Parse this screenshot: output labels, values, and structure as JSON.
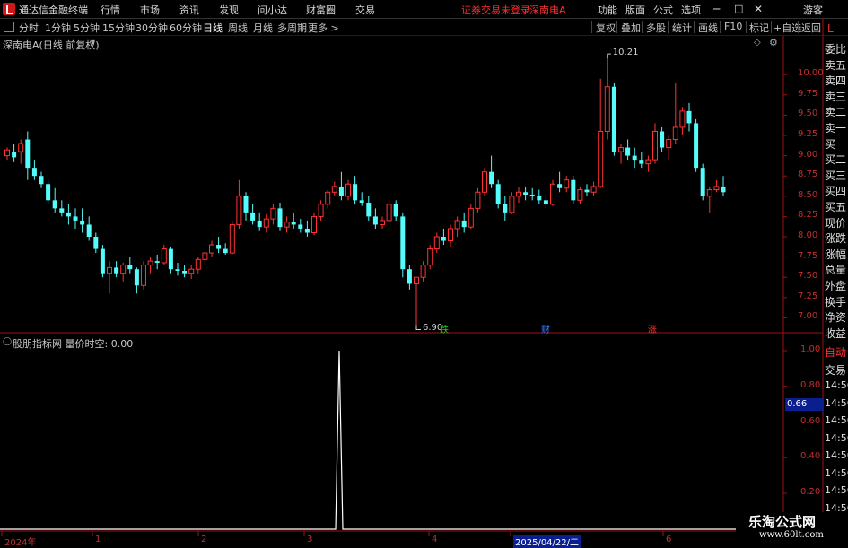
{
  "menubar": {
    "app_title": "通达信金融终端",
    "menus": [
      "行情",
      "市场",
      "资讯",
      "发现",
      "问小达",
      "财富圈",
      "交易"
    ],
    "status_text": "证券交易未登录",
    "stock_name": "深南电A",
    "right_menus": [
      "功能",
      "版面",
      "公式",
      "选项"
    ],
    "guest_label": "游客"
  },
  "periodbar": {
    "periods": [
      "分时",
      "1分钟",
      "5分钟",
      "15分钟",
      "30分钟",
      "60分钟",
      "日线",
      "周线",
      "月线",
      "多周期",
      "更多 >"
    ],
    "active_period": "日线",
    "tools": [
      "复权",
      "叠加",
      "多股",
      "统计",
      "画线",
      "F10",
      "标记",
      "+自选",
      "返回"
    ]
  },
  "main_chart": {
    "title": "深南电A(日线 前复权)",
    "high_label": "10.21",
    "low_label": "6.90",
    "y_ticks": [
      "10.00",
      "9.75",
      "9.50",
      "9.25",
      "9.00",
      "8.75",
      "8.50",
      "8.25",
      "8.00",
      "7.75",
      "7.50",
      "7.25",
      "7.00"
    ],
    "markers": [
      {
        "text": "跌",
        "color": "#22cc22"
      },
      {
        "text": "财",
        "color": "#3a78ff"
      },
      {
        "text": "涨",
        "color": "#ff3030"
      }
    ],
    "colors": {
      "up": "#ff3333",
      "down": "#54fcfc",
      "axis": "#a01010"
    }
  },
  "indicator": {
    "title": "股朋指标网  量价时空: 0.00",
    "y_ticks": [
      "1.00",
      "0.80",
      "0.60",
      "0.40",
      "0.20"
    ],
    "current_value": "0.66",
    "line_color": "#ffffff"
  },
  "right_panel": {
    "header": "L",
    "items": [
      "委比",
      "卖五",
      "卖四",
      "卖三",
      "卖二",
      "卖一",
      "买一",
      "买二",
      "买三",
      "买四",
      "买五",
      "现价",
      "涨跌",
      "涨幅",
      "总量",
      "外盘",
      "换手",
      "净资",
      "收益"
    ],
    "lower_items": [
      "自动",
      "交易",
      "14:56",
      "14:56",
      "14:56",
      "14:56",
      "14:56",
      "14:56",
      "14:56",
      "14:56",
      "14:56"
    ]
  },
  "date_axis": {
    "labels": [
      "2024年",
      "1",
      "2",
      "3",
      "4",
      "2025/04/22/二",
      "6"
    ]
  },
  "watermark": {
    "title": "乐淘公式网",
    "url": "www.60lt.com"
  },
  "chart_data": {
    "type": "candlestick",
    "title": "深南电A(日线 前复权)",
    "ylim": [
      6.85,
      10.4
    ],
    "candles": [
      [
        9.0,
        9.1,
        8.95,
        9.07
      ],
      [
        9.05,
        9.15,
        8.92,
        8.98
      ],
      [
        9.05,
        9.2,
        8.9,
        9.15
      ],
      [
        9.2,
        9.3,
        8.7,
        8.85
      ],
      [
        8.85,
        8.95,
        8.7,
        8.75
      ],
      [
        8.75,
        8.8,
        8.6,
        8.65
      ],
      [
        8.65,
        8.7,
        8.4,
        8.45
      ],
      [
        8.45,
        8.6,
        8.3,
        8.35
      ],
      [
        8.35,
        8.45,
        8.25,
        8.3
      ],
      [
        8.3,
        8.4,
        8.15,
        8.25
      ],
      [
        8.25,
        8.35,
        8.1,
        8.2
      ],
      [
        8.2,
        8.35,
        8.05,
        8.15
      ],
      [
        8.15,
        8.25,
        7.95,
        8.0
      ],
      [
        8.0,
        8.05,
        7.8,
        7.85
      ],
      [
        7.85,
        7.9,
        7.5,
        7.55
      ],
      [
        7.55,
        7.7,
        7.3,
        7.62
      ],
      [
        7.62,
        7.7,
        7.5,
        7.55
      ],
      [
        7.55,
        7.68,
        7.45,
        7.65
      ],
      [
        7.65,
        7.75,
        7.55,
        7.6
      ],
      [
        7.6,
        7.62,
        7.3,
        7.4
      ],
      [
        7.4,
        7.7,
        7.35,
        7.65
      ],
      [
        7.65,
        7.75,
        7.55,
        7.7
      ],
      [
        7.7,
        7.78,
        7.6,
        7.68
      ],
      [
        7.68,
        7.9,
        7.65,
        7.85
      ],
      [
        7.85,
        7.88,
        7.55,
        7.6
      ],
      [
        7.6,
        7.68,
        7.52,
        7.58
      ],
      [
        7.58,
        7.65,
        7.5,
        7.55
      ],
      [
        7.55,
        7.65,
        7.48,
        7.6
      ],
      [
        7.6,
        7.75,
        7.55,
        7.72
      ],
      [
        7.72,
        7.82,
        7.65,
        7.8
      ],
      [
        7.8,
        7.95,
        7.75,
        7.9
      ],
      [
        7.9,
        8.0,
        7.8,
        7.85
      ],
      [
        7.85,
        7.92,
        7.78,
        7.8
      ],
      [
        7.8,
        8.2,
        7.78,
        8.15
      ],
      [
        8.15,
        8.7,
        8.1,
        8.5
      ],
      [
        8.5,
        8.55,
        8.2,
        8.3
      ],
      [
        8.3,
        8.4,
        8.15,
        8.2
      ],
      [
        8.2,
        8.3,
        8.08,
        8.12
      ],
      [
        8.12,
        8.28,
        8.05,
        8.22
      ],
      [
        8.22,
        8.4,
        8.15,
        8.35
      ],
      [
        8.35,
        8.42,
        8.08,
        8.12
      ],
      [
        8.12,
        8.25,
        8.05,
        8.18
      ],
      [
        8.18,
        8.3,
        8.1,
        8.15
      ],
      [
        8.15,
        8.22,
        8.05,
        8.1
      ],
      [
        8.1,
        8.2,
        8.0,
        8.05
      ],
      [
        8.05,
        8.3,
        8.02,
        8.25
      ],
      [
        8.25,
        8.45,
        8.2,
        8.4
      ],
      [
        8.4,
        8.58,
        8.35,
        8.55
      ],
      [
        8.55,
        8.68,
        8.5,
        8.62
      ],
      [
        8.62,
        8.8,
        8.45,
        8.5
      ],
      [
        8.5,
        8.7,
        8.45,
        8.65
      ],
      [
        8.65,
        8.75,
        8.4,
        8.45
      ],
      [
        8.45,
        8.55,
        8.38,
        8.42
      ],
      [
        8.42,
        8.5,
        8.2,
        8.25
      ],
      [
        8.25,
        8.35,
        8.1,
        8.15
      ],
      [
        8.15,
        8.25,
        8.1,
        8.2
      ],
      [
        8.2,
        8.45,
        8.15,
        8.4
      ],
      [
        8.4,
        8.45,
        8.2,
        8.25
      ],
      [
        8.25,
        8.3,
        7.5,
        7.6
      ],
      [
        7.6,
        7.65,
        7.35,
        7.42
      ],
      [
        7.42,
        7.5,
        6.9,
        7.5
      ],
      [
        7.5,
        7.7,
        7.45,
        7.65
      ],
      [
        7.65,
        7.9,
        7.6,
        7.85
      ],
      [
        7.85,
        8.05,
        7.8,
        8.0
      ],
      [
        8.0,
        8.1,
        7.9,
        7.95
      ],
      [
        7.95,
        8.15,
        7.88,
        8.1
      ],
      [
        8.1,
        8.25,
        8.0,
        8.2
      ],
      [
        8.2,
        8.3,
        8.05,
        8.12
      ],
      [
        8.12,
        8.4,
        8.1,
        8.35
      ],
      [
        8.35,
        8.6,
        8.3,
        8.55
      ],
      [
        8.55,
        8.85,
        8.5,
        8.8
      ],
      [
        8.8,
        9.0,
        8.6,
        8.65
      ],
      [
        8.65,
        8.7,
        8.35,
        8.4
      ],
      [
        8.4,
        8.5,
        8.2,
        8.3
      ],
      [
        8.3,
        8.55,
        8.28,
        8.5
      ],
      [
        8.5,
        8.62,
        8.42,
        8.55
      ],
      [
        8.55,
        8.62,
        8.45,
        8.52
      ],
      [
        8.52,
        8.6,
        8.45,
        8.5
      ],
      [
        8.5,
        8.58,
        8.4,
        8.45
      ],
      [
        8.45,
        8.52,
        8.35,
        8.4
      ],
      [
        8.4,
        8.7,
        8.38,
        8.65
      ],
      [
        8.65,
        8.8,
        8.55,
        8.6
      ],
      [
        8.6,
        8.75,
        8.55,
        8.7
      ],
      [
        8.7,
        8.75,
        8.4,
        8.45
      ],
      [
        8.45,
        8.62,
        8.4,
        8.58
      ],
      [
        8.58,
        8.65,
        8.5,
        8.55
      ],
      [
        8.55,
        8.68,
        8.5,
        8.62
      ],
      [
        8.62,
        9.95,
        8.6,
        9.3
      ],
      [
        9.3,
        10.21,
        9.2,
        9.85
      ],
      [
        9.85,
        9.9,
        9.0,
        9.05
      ],
      [
        9.05,
        9.15,
        8.9,
        9.1
      ],
      [
        9.1,
        9.2,
        8.95,
        9.0
      ],
      [
        9.0,
        9.1,
        8.85,
        8.95
      ],
      [
        8.95,
        9.05,
        8.85,
        8.9
      ],
      [
        8.9,
        9.0,
        8.8,
        8.95
      ],
      [
        8.95,
        9.4,
        8.9,
        9.3
      ],
      [
        9.3,
        9.35,
        9.05,
        9.1
      ],
      [
        9.1,
        9.25,
        8.95,
        9.2
      ],
      [
        9.2,
        9.9,
        9.15,
        9.35
      ],
      [
        9.35,
        9.6,
        9.25,
        9.55
      ],
      [
        9.55,
        9.65,
        9.3,
        9.4
      ],
      [
        9.4,
        9.45,
        8.8,
        8.85
      ],
      [
        8.85,
        8.9,
        8.45,
        8.5
      ],
      [
        8.5,
        8.62,
        8.3,
        8.58
      ],
      [
        8.58,
        8.7,
        8.55,
        8.62
      ],
      [
        8.62,
        8.75,
        8.5,
        8.55
      ]
    ]
  }
}
